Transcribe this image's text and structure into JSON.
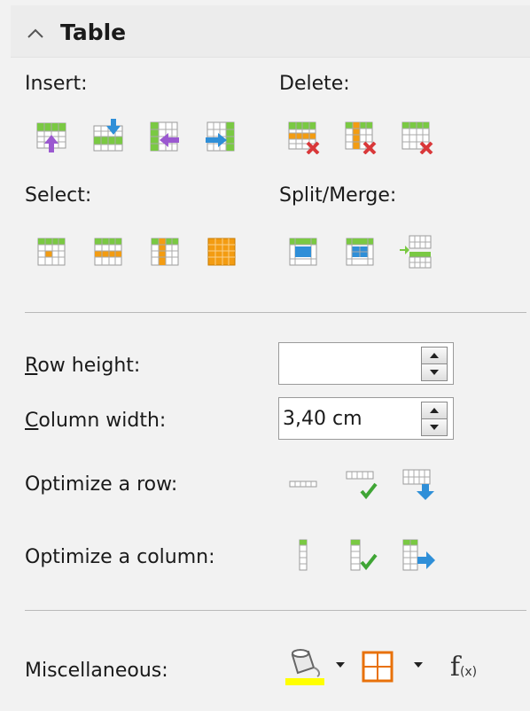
{
  "section": {
    "title": "Table",
    "expanded": true
  },
  "insert": {
    "label": "Insert:",
    "buttons": [
      "insert-rows-above",
      "insert-rows-below",
      "insert-columns-before",
      "insert-columns-after"
    ]
  },
  "delete": {
    "label": "Delete:",
    "buttons": [
      "delete-rows",
      "delete-columns",
      "delete-table"
    ]
  },
  "select": {
    "label": "Select:",
    "buttons": [
      "select-cell",
      "select-row",
      "select-column",
      "select-table"
    ]
  },
  "split_merge": {
    "label": "Split/Merge:",
    "buttons": [
      "merge-cells",
      "split-cells",
      "split-table"
    ]
  },
  "row_height": {
    "label": "Row height:",
    "value": ""
  },
  "column_width": {
    "label": "Column width:",
    "value": "3,40 cm"
  },
  "optimize_row": {
    "label": "Optimize a row:",
    "buttons": [
      "minimal-row-height",
      "optimal-row-height",
      "distribute-rows-evenly"
    ]
  },
  "optimize_column": {
    "label": "Optimize a column:",
    "buttons": [
      "minimal-column-width",
      "optimal-column-width",
      "distribute-columns-evenly"
    ]
  },
  "misc": {
    "label": "Miscellaneous:",
    "function_label": "f",
    "function_sub": "(x)"
  },
  "colors": {
    "green": "#7ac943",
    "orange": "#f39c12",
    "blue": "#2f8fd8",
    "purple": "#9b59d0",
    "red": "#d9383a",
    "highlight": "#ffff00"
  }
}
